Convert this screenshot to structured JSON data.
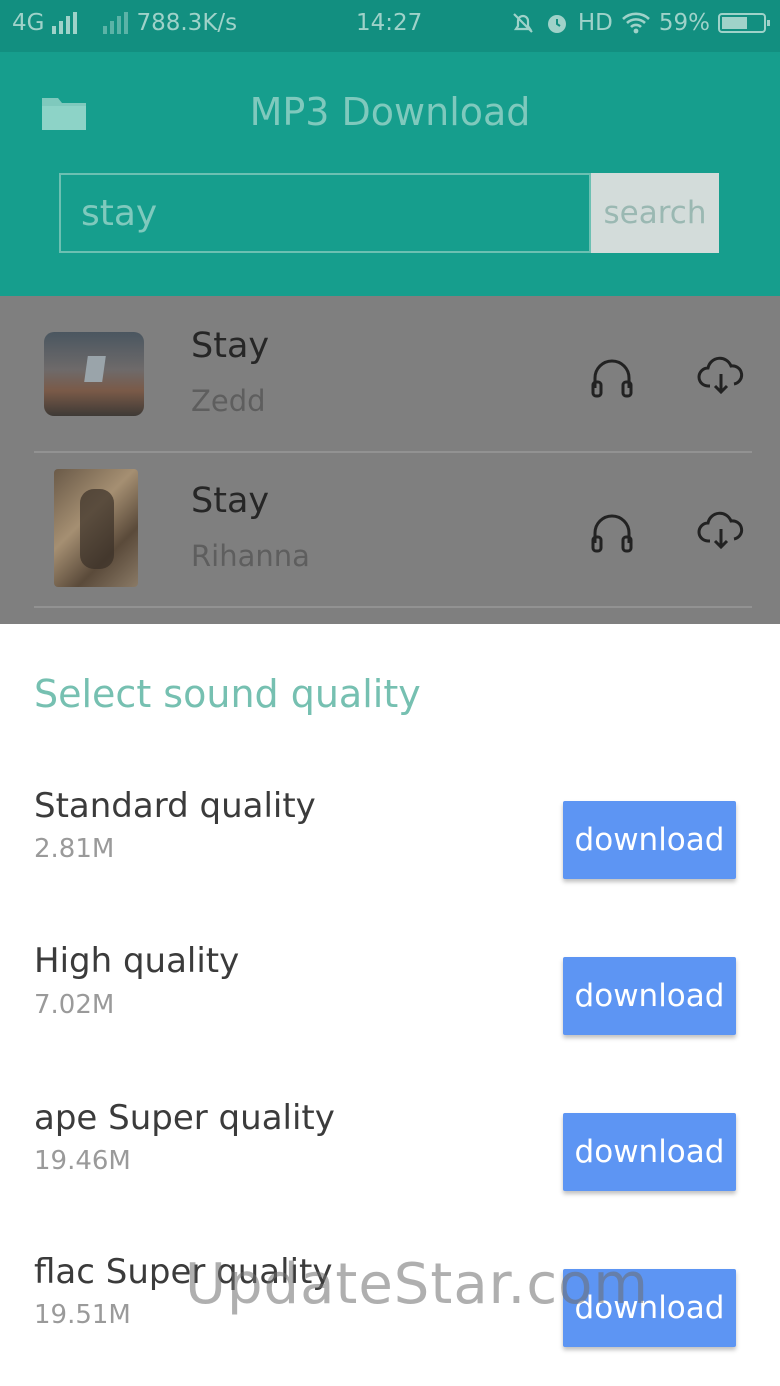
{
  "status_bar": {
    "network": "4G",
    "speed": "788.3K/s",
    "time": "14:27",
    "hd": "HD",
    "battery": "59%"
  },
  "app_bar": {
    "title": "MP3 Download",
    "search_value": "stay",
    "search_button": "search"
  },
  "results": [
    {
      "title": "Stay",
      "artist": "Zedd"
    },
    {
      "title": "Stay",
      "artist": "Rihanna"
    }
  ],
  "sheet": {
    "title": "Select sound quality",
    "options": [
      {
        "name": "Standard quality",
        "size": "2.81M",
        "button": "download"
      },
      {
        "name": "High quality",
        "size": "7.02M",
        "button": "download"
      },
      {
        "name": "ape Super quality",
        "size": "19.46M",
        "button": "download"
      },
      {
        "name": "flac Super quality",
        "size": "19.51M",
        "button": "download"
      }
    ]
  },
  "watermark": "UpdateStar.com",
  "colors": {
    "header": "#169e8d",
    "accent_text": "#76c0b1",
    "download_button": "#5d95f3"
  }
}
